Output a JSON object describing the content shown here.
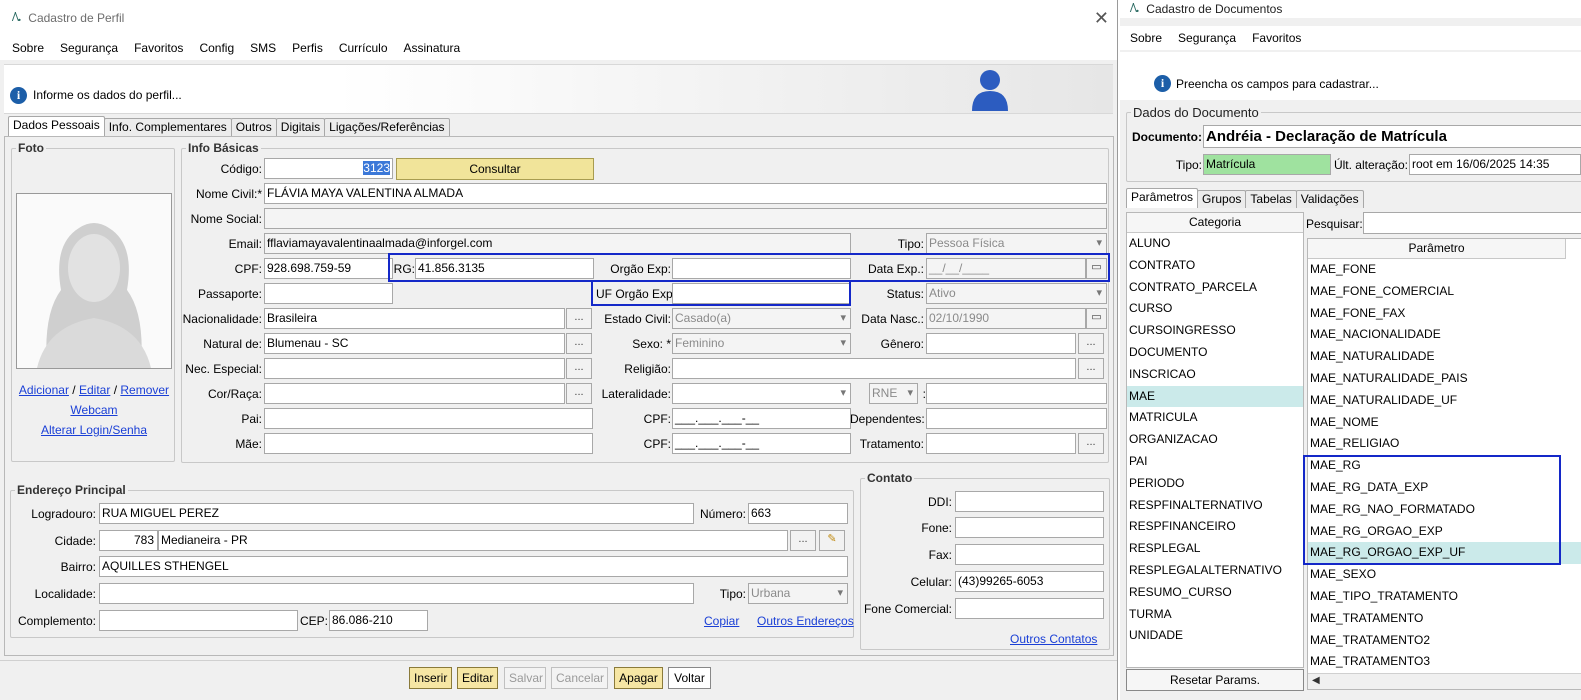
{
  "profile": {
    "title": "Cadastro de Perfil",
    "menu": [
      "Sobre",
      "Segurança",
      "Favoritos",
      "Config",
      "SMS",
      "Perfis",
      "Currículo",
      "Assinatura"
    ],
    "info": "Informe os dados do perfil...",
    "tabs": [
      "Dados Pessoais",
      "Info. Complementares",
      "Outros",
      "Digitais",
      "Ligações/Referências"
    ],
    "foto_title": "Foto",
    "foto_links": {
      "adicionar": "Adicionar",
      "editar": "Editar",
      "remover": "Remover",
      "sep": "/",
      "webcam": "Webcam",
      "alterar": "Alterar Login/Senha"
    },
    "basic_title": "Info Básicas",
    "labels": {
      "codigo": "Código:",
      "nome_civil": "Nome Civil:*",
      "nome_social": "Nome Social:",
      "email": "Email:",
      "tipo": "Tipo:",
      "cpf": "CPF:",
      "rg": "RG:",
      "orgao_exp": "Orgão Exp:",
      "data_exp": "Data Exp.:",
      "passaporte": "Passaporte:",
      "uf_orgao": "UF Orgão Exp:",
      "status": "Status:",
      "nacionalidade": "Nacionalidade:",
      "estado_civil": "Estado Civil:",
      "data_nasc": "Data Nasc.:",
      "natural": "Natural de:",
      "sexo": "Sexo: *",
      "genero": "Gênero:",
      "nec_especial": "Nec. Especial:",
      "religiao": "Religião:",
      "cor_raca": "Cor/Raça:",
      "lateralidade": "Lateralidade:",
      "pai": "Pai:",
      "cpf_pai": "CPF:",
      "dependentes": "Dependentes:",
      "mae": "Mãe:",
      "cpf_mae": "CPF:",
      "tratamento": "Tratamento:",
      "colon": ":"
    },
    "values": {
      "codigo": "3123",
      "consultar": "Consultar",
      "nome_civil": "FLÁVIA MAYA VALENTINA ALMADA",
      "nome_social": "",
      "email": "fflaviamayavalentinaalmada@inforgel.com",
      "tipo": "Pessoa Física",
      "cpf": "928.698.759-59",
      "rg": "41.856.3135",
      "orgao_exp": "",
      "data_exp": "__/__/____",
      "passaporte": "",
      "uf_orgao": "",
      "status": "Ativo",
      "nacionalidade": "Brasileira",
      "estado_civil": "Casado(a)",
      "data_nasc": "02/10/1990",
      "natural": "Blumenau - SC",
      "sexo": "Feminino",
      "genero": "",
      "nec_especial": "",
      "religiao": "",
      "cor_raca": "",
      "lateralidade": "",
      "rne": "RNE",
      "rne_value": "",
      "pai": "",
      "cpf_pai": "___.___.___-__",
      "dependentes": "",
      "mae": "",
      "cpf_mae": "___.___.___-__",
      "tratamento": "",
      "ellipsis": "..."
    },
    "address_title": "Endereço Principal",
    "address_labels": {
      "logradouro": "Logradouro:",
      "numero": "Número:",
      "cidade": "Cidade:",
      "bairro": "Bairro:",
      "localidade": "Localidade:",
      "tipo": "Tipo:",
      "complemento": "Complemento:",
      "cep": "CEP:"
    },
    "address_values": {
      "logradouro": "RUA MIGUEL PEREZ",
      "numero": "663",
      "cidade_cod": "783",
      "cidade": "Medianeira - PR",
      "bairro": "AQUILLES STHENGEL",
      "localidade": "",
      "tipo": "Urbana",
      "complemento": "",
      "cep": "86.086-210"
    },
    "address_links": {
      "copiar": "Copiar",
      "outros": "Outros Endereços"
    },
    "contact_title": "Contato",
    "contact_labels": {
      "ddi": "DDI:",
      "fone": "Fone:",
      "fax": "Fax:",
      "celular": "Celular:",
      "fone_com": "Fone Comercial:"
    },
    "contact_values": {
      "ddi": "",
      "fone": "",
      "fax": "",
      "celular": "(43)99265-6053",
      "fone_com": ""
    },
    "contact_link": "Outros Contatos",
    "buttons": {
      "inserir": "Inserir",
      "editar": "Editar",
      "salvar": "Salvar",
      "cancelar": "Cancelar",
      "apagar": "Apagar",
      "voltar": "Voltar"
    }
  },
  "docs": {
    "title": "Cadastro de Documentos",
    "menu": [
      "Sobre",
      "Segurança",
      "Favoritos"
    ],
    "info": "Preencha os campos para cadastrar...",
    "group_title": "Dados do Documento",
    "documento_label": "Documento:",
    "documento": "Andréia - Declaração de Matrícula",
    "tipo_label": "Tipo:",
    "tipo": "Matrícula",
    "ult_label": "Últ. alteração:",
    "ult": "root em 16/06/2025 14:35",
    "tabs": [
      "Parâmetros",
      "Grupos",
      "Tabelas",
      "Validações"
    ],
    "categoria_header": "Categoria",
    "categorias": [
      "ALUNO",
      "CONTRATO",
      "CONTRATO_PARCELA",
      "CURSO",
      "CURSOINGRESSO",
      "DOCUMENTO",
      "INSCRICAO",
      "MAE",
      "MATRICULA",
      "ORGANIZACAO",
      "PAI",
      "PERIODO",
      "RESPFINALTERNATIVO",
      "RESPFINANCEIRO",
      "RESPLEGAL",
      "RESPLEGALALTERNATIVO",
      "RESUMO_CURSO",
      "TURMA",
      "UNIDADE"
    ],
    "pesquisar_label": "Pesquisar:",
    "pesquisar": "",
    "parametro_header": "Parâmetro",
    "parametros": [
      "MAE_FONE",
      "MAE_FONE_COMERCIAL",
      "MAE_FONE_FAX",
      "MAE_NACIONALIDADE",
      "MAE_NATURALIDADE",
      "MAE_NATURALIDADE_PAIS",
      "MAE_NATURALIDADE_UF",
      "MAE_NOME",
      "MAE_RELIGIAO",
      "MAE_RG",
      "MAE_RG_DATA_EXP",
      "MAE_RG_NAO_FORMATADO",
      "MAE_RG_ORGAO_EXP",
      "MAE_RG_ORGAO_EXP_UF",
      "MAE_SEXO",
      "MAE_TIPO_TRATAMENTO",
      "MAE_TRATAMENTO",
      "MAE_TRATAMENTO2",
      "MAE_TRATAMENTO3"
    ],
    "reset_button": "Resetar Params."
  },
  "colors": {
    "highlight_box": "#1428c8",
    "selection": "#cbeaea",
    "link": "#1a3fd6",
    "button_yellow": "#f6e6a4",
    "tipo_green": "#9fe29f"
  }
}
